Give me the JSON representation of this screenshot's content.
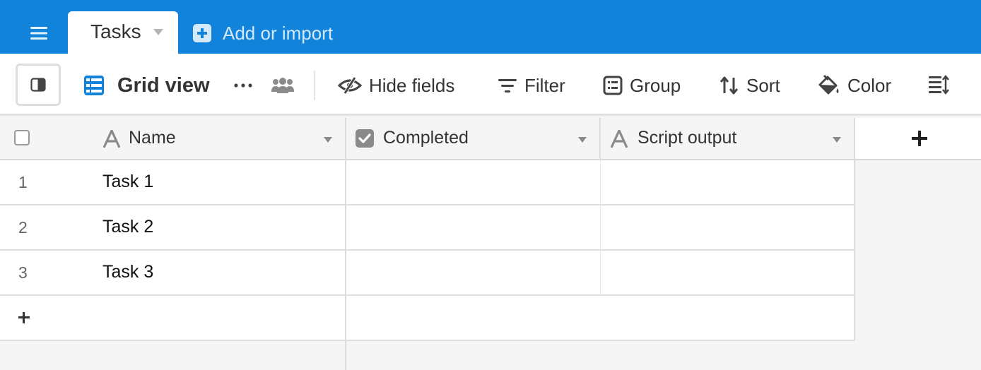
{
  "topbar": {
    "tab": {
      "label": "Tasks"
    },
    "add_import_label": "Add or import",
    "color": "#1283da"
  },
  "toolbar": {
    "view_name": "Grid view",
    "hide_fields_label": "Hide fields",
    "filter_label": "Filter",
    "group_label": "Group",
    "sort_label": "Sort",
    "color_label": "Color"
  },
  "grid": {
    "columns": [
      {
        "label": "Name",
        "type_icon": "text-type-icon"
      },
      {
        "label": "Completed",
        "type_icon": "checkbox-type-icon"
      },
      {
        "label": "Script output",
        "type_icon": "text-type-icon"
      }
    ],
    "rows": [
      {
        "number": "1",
        "name": "Task 1",
        "completed": "",
        "script_output": ""
      },
      {
        "number": "2",
        "name": "Task 2",
        "completed": "",
        "script_output": ""
      },
      {
        "number": "3",
        "name": "Task 3",
        "completed": "",
        "script_output": ""
      }
    ]
  }
}
